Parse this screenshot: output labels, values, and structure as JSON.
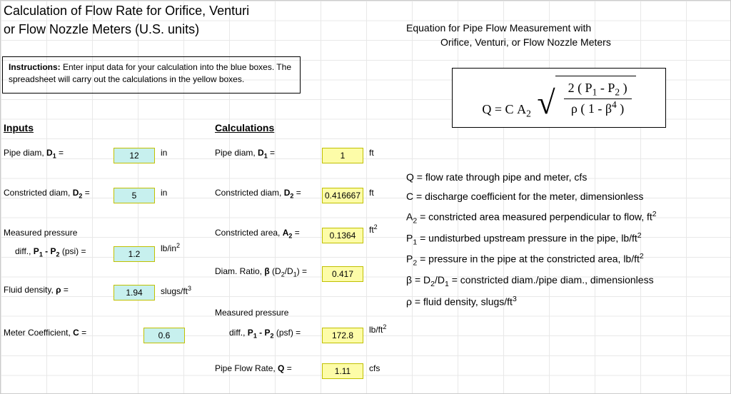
{
  "title_line1": "Calculation of Flow Rate for Orifice, Venturi",
  "title_line2": "or Flow Nozzle  Meters  (U.S. units)",
  "instructions_label": "Instructions:",
  "instructions_text": " Enter input data for your calculation into the blue boxes.  The spreadsheet will carry out the calculations in the yellow boxes.",
  "inputs_heading": "Inputs",
  "calculations_heading": "Calculations",
  "inputs": {
    "pipe_diam": {
      "label_pre": "Pipe diam, ",
      "label_sym": "D",
      "label_sub": "1",
      "label_post": " =",
      "value": "12",
      "unit": "in"
    },
    "constricted_diam": {
      "label_pre": "Constricted diam, ",
      "label_sym": "D",
      "label_sub": "2",
      "label_post": " =",
      "value": "5",
      "unit": "in"
    },
    "measured_pressure_title": "Measured pressure",
    "dp": {
      "label_pre": "diff., ",
      "label_sym": "P",
      "label_sub1": "1",
      "label_mid": " - P",
      "label_sub2": "2",
      "label_post": "  (psi)  =",
      "value": "1.2",
      "unit": "lb/in",
      "unit_sup": "2"
    },
    "density": {
      "label_pre": "Fluid density, ",
      "label_sym": "ρ",
      "label_post": "  =",
      "value": "1.94",
      "unit": "slugs/ft",
      "unit_sup": "3"
    },
    "coeff": {
      "label_pre": "Meter Coefficient, ",
      "label_sym": "C",
      "label_post": "  =",
      "value": "0.6",
      "unit": ""
    }
  },
  "calc": {
    "pipe_diam": {
      "label_pre": "Pipe diam, ",
      "label_sym": "D",
      "label_sub": "1",
      "label_post": " =",
      "value": "1",
      "unit": "ft"
    },
    "constricted_diam": {
      "label_pre": "Constricted diam, ",
      "label_sym": "D",
      "label_sub": "2",
      "label_post": " =",
      "value": "0.416667",
      "unit": "ft"
    },
    "area": {
      "label_pre": "Constricted area, ",
      "label_sym": "A",
      "label_sub": "2",
      "label_post": " =",
      "value": "0.1364",
      "unit": "ft",
      "unit_sup": "2"
    },
    "beta": {
      "label_pre": "Diam. Ratio, ",
      "label_sym": "β",
      "label_post_html": " (D<sub>2</sub>/D<sub>1</sub>)  =",
      "value": "0.417",
      "unit": ""
    },
    "measured_pressure_title": "Measured pressure",
    "dp": {
      "label_pre": "diff., ",
      "label_sym": "P",
      "label_sub1": "1",
      "label_mid": " - P",
      "label_sub2": "2",
      "label_post": "  (psf)  =",
      "value": "172.8",
      "unit": "lb/ft",
      "unit_sup": "2"
    },
    "flow": {
      "label_pre": "Pipe Flow Rate, ",
      "label_sym": "Q",
      "label_post": "  =",
      "value": "1.11",
      "unit": "cfs"
    }
  },
  "equation": {
    "title": "Equation for Pipe Flow Measurement with",
    "subtitle": "Orifice, Venturi, or Flow Nozzle Meters",
    "lhs_Q": "Q",
    "eq": " = ",
    "C": "C",
    "A": "A",
    "A_sub": "2",
    "num_pre": "2 ( P",
    "num_sub1": "1",
    "num_mid": " - P",
    "num_sub2": "2",
    "num_post": " )",
    "den_pre": "ρ ( 1 - β",
    "den_sup": "4",
    "den_post": " )"
  },
  "defs": {
    "q": {
      "lhs": "Q = ",
      "rhs": "flow rate through pipe and meter, cfs"
    },
    "c": {
      "lhs": "C = ",
      "rhs": "discharge coefficient for the meter, dimensionless"
    },
    "a2": {
      "lhs_pre": "A",
      "lhs_sub": "2",
      "lhs_post": " = ",
      "rhs": "constricted area measured perpendicular to flow, ft",
      "rhs_sup": "2"
    },
    "p1": {
      "lhs_pre": "P",
      "lhs_sub": "1",
      "lhs_post": " = ",
      "rhs": "undisturbed upstream pressure in the pipe, lb/ft",
      "rhs_sup": "2"
    },
    "p2": {
      "lhs_pre": "P",
      "lhs_sub": "2",
      "lhs_post": " = ",
      "rhs": "pressure in the pipe at the constricted area, lb/ft",
      "rhs_sup": "2"
    },
    "beta": {
      "lhs": "β = ",
      "rhs_html": "D<sub>2</sub>/D<sub>1</sub> = constricted diam./pipe diam., dimensionless"
    },
    "rho": {
      "lhs": "ρ = ",
      "rhs": "fluid density, slugs/ft",
      "rhs_sup": "3"
    }
  }
}
